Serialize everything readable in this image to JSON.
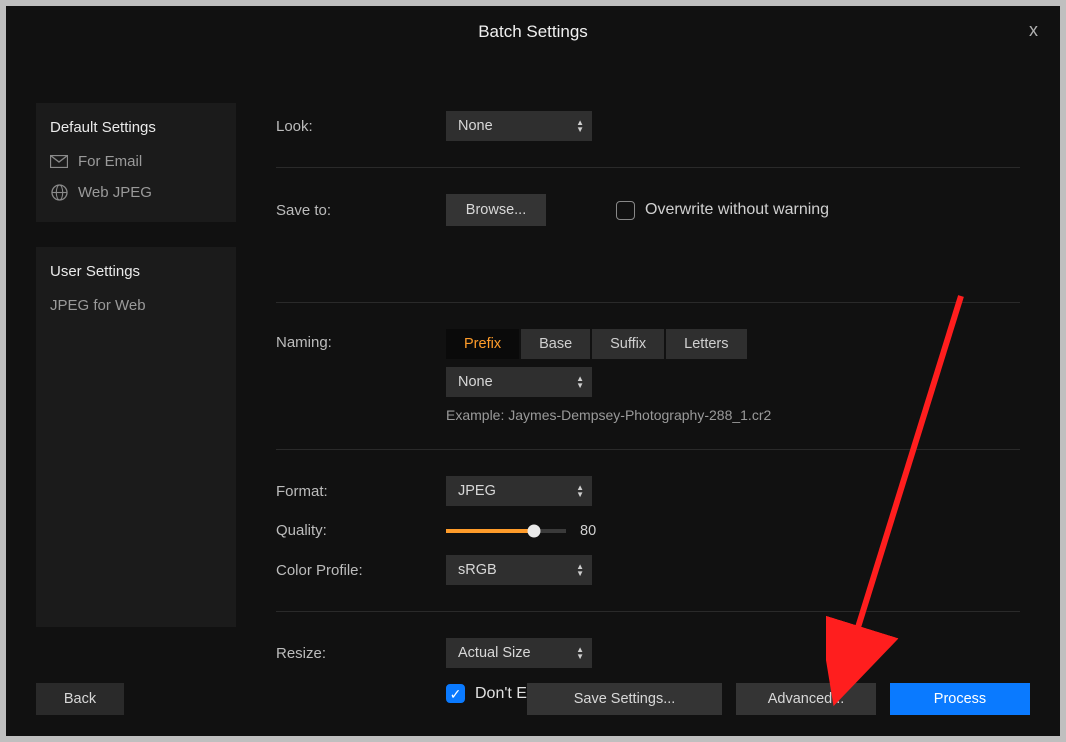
{
  "title": "Batch Settings",
  "close_glyph": "x",
  "sidebar": {
    "default_header": "Default Settings",
    "default_items": [
      {
        "label": "For Email",
        "icon": "mail-icon"
      },
      {
        "label": "Web JPEG",
        "icon": "globe-icon"
      }
    ],
    "user_header": "User Settings",
    "user_items": [
      {
        "label": "JPEG for Web"
      }
    ]
  },
  "look": {
    "label": "Look:",
    "value": "None"
  },
  "saveto": {
    "label": "Save to:",
    "browse": "Browse...",
    "overwrite_label": "Overwrite without warning"
  },
  "naming": {
    "label": "Naming:",
    "tabs": [
      "Prefix",
      "Base",
      "Suffix",
      "Letters"
    ],
    "active_tab": "Prefix",
    "value": "None",
    "example": "Example: Jaymes-Dempsey-Photography-288_1.cr2"
  },
  "format": {
    "label": "Format:",
    "value": "JPEG"
  },
  "quality": {
    "label": "Quality:",
    "value": 80,
    "fill_pct": 73
  },
  "profile": {
    "label": "Color Profile:",
    "value": "sRGB"
  },
  "resize": {
    "label": "Resize:",
    "value": "Actual Size",
    "dont_enlarge": "Don't Enlarge"
  },
  "footer": {
    "back": "Back",
    "save": "Save Settings...",
    "advanced": "Advanced...",
    "process": "Process"
  }
}
